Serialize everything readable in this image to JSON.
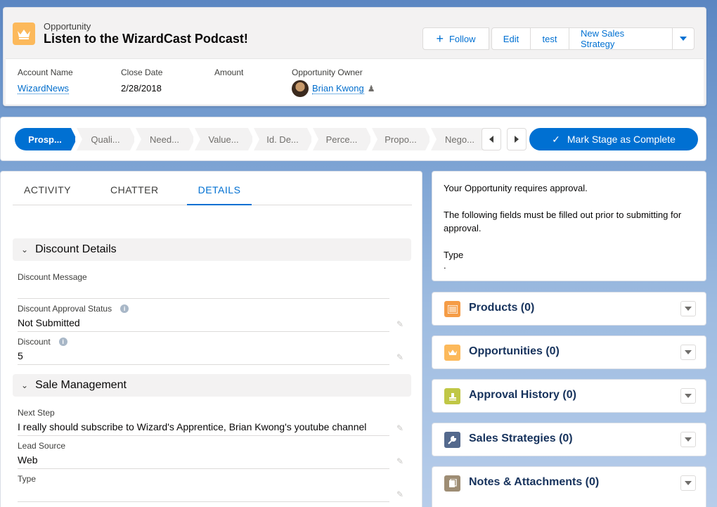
{
  "header": {
    "record_type": "Opportunity",
    "title": "Listen to the WizardCast Podcast!",
    "icon": "crown-icon",
    "icon_color": "#fcb95b",
    "buttons": {
      "follow": "Follow",
      "edit": "Edit",
      "test": "test",
      "new_sales_strategy": "New Sales Strategy"
    }
  },
  "highlights": {
    "account_name_label": "Account Name",
    "account_name": "WizardNews",
    "close_date_label": "Close Date",
    "close_date": "2/28/2018",
    "amount_label": "Amount",
    "amount": "",
    "owner_label": "Opportunity Owner",
    "owner": "Brian Kwong"
  },
  "path": {
    "stages": [
      "Prosp...",
      "Quali...",
      "Need...",
      "Value...",
      "Id. De...",
      "Perce...",
      "Propo...",
      "Nego..."
    ],
    "current_index": 0,
    "mark_complete": "Mark Stage as Complete",
    "accent": "#0070d2"
  },
  "tabs": [
    "ACTIVITY",
    "CHATTER",
    "DETAILS"
  ],
  "active_tab": "DETAILS",
  "sections": {
    "discount": {
      "title": "Discount Details",
      "fields": [
        {
          "label": "Discount Message",
          "value": ""
        },
        {
          "label": "Discount Approval Status",
          "value": "Not Submitted"
        },
        {
          "label": "Discount",
          "value": "5"
        }
      ]
    },
    "sale": {
      "title": "Sale Management",
      "fields": [
        {
          "label": "Next Step",
          "value": "I really should subscribe to Wizard's Apprentice, Brian Kwong's youtube channel"
        },
        {
          "label": "Lead Source",
          "value": "Web"
        },
        {
          "label": "Type",
          "value": ""
        }
      ]
    }
  },
  "approval": {
    "line1": "Your Opportunity requires approval.",
    "line2": "The following fields must be filled out prior to submitting for approval.",
    "field": "Type",
    "dot": "."
  },
  "related": [
    {
      "title": "Products (0)",
      "icon": "products-icon",
      "color": "#f59c46"
    },
    {
      "title": "Opportunities (0)",
      "icon": "crown-icon",
      "color": "#fcb95b"
    },
    {
      "title": "Approval History (0)",
      "icon": "approval-icon",
      "color": "#c0c746"
    },
    {
      "title": "Sales Strategies (0)",
      "icon": "wrench-icon",
      "color": "#54698d"
    },
    {
      "title": "Notes & Attachments (0)",
      "icon": "notes-icon",
      "color": "#9e8d74"
    }
  ]
}
